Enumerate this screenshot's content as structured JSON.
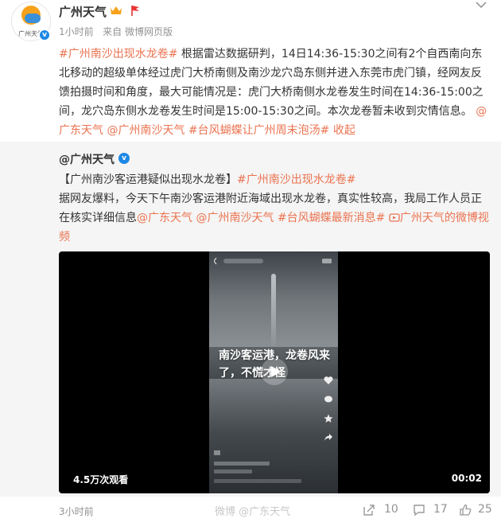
{
  "header": {
    "user_name": "广州天气",
    "avatar_label": "广州天气",
    "time": "1小时前",
    "source": "来自 微博网页版"
  },
  "post": {
    "tag1": "#广州南沙出现水龙卷#",
    "body": "根据雷达数据研判，14日14:36-15:30之间有2个自西南向东北移动的超级单体经过虎门大桥南侧及南沙龙穴岛东侧并进入东莞市虎门镇，经网友反馈拍摄时间和角度，最大可能情况是：虎门大桥南侧水龙卷发生时间在14:36-15:00之间，龙穴岛东侧水龙卷发生时间是15:00-15:30之间。本次龙卷暂未收到灾情信息。",
    "mention1": "@广东天气",
    "mention2": "@广州南沙天气",
    "tag2": "#台风蝴蝶让广州周末泡汤#",
    "collapse": "收起"
  },
  "repost": {
    "user_name": "@广州天气",
    "title": "【广州南沙客运港疑似出现水龙卷】",
    "tag1": "#广州南沙出现水龙卷#",
    "body": "据网友爆料，今天下午南沙客运港附近海域出现水龙卷，真实性较高，我局工作人员正在核实详细信息",
    "mention1": "@广东天气",
    "mention2": "@广州南沙天气",
    "tag2": "#台风蝴蝶最新消息#",
    "video_link": "广州天气的微博视频"
  },
  "video": {
    "caption": "南沙客运港，龙卷风来了，不慌才怪",
    "views": "4.5万次观看",
    "duration": "00:02"
  },
  "footer": {
    "time": "3小时前",
    "watermark": "微博 @广东天气",
    "reposts": "10",
    "comments": "17",
    "likes": "25"
  },
  "colors": {
    "accent": "#eb7350",
    "meta": "#939393",
    "repost_bg": "#f5f5f5"
  }
}
